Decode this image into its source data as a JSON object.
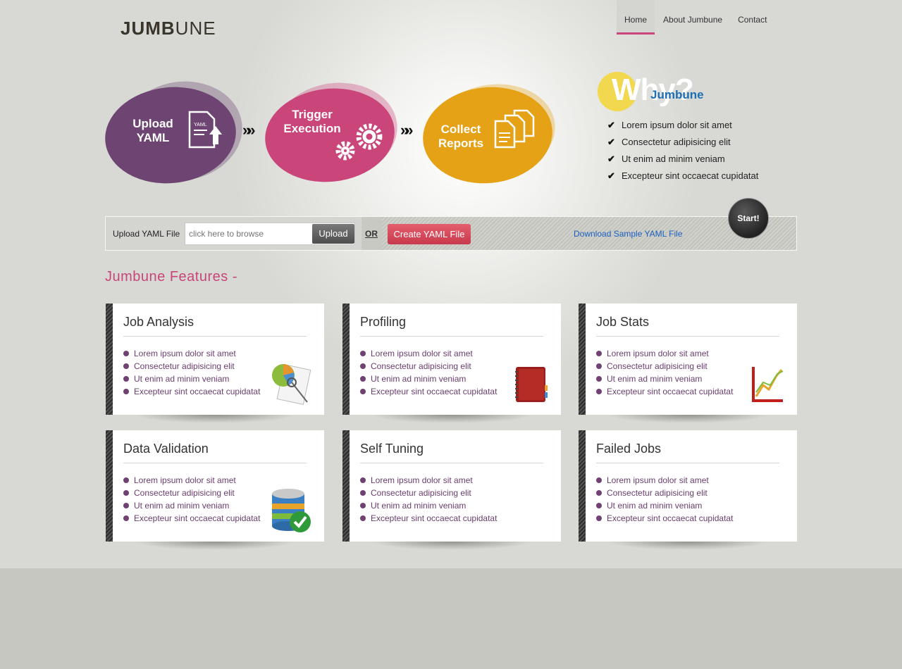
{
  "logo": {
    "bold": "JUMB",
    "rest": "UNE"
  },
  "nav": [
    {
      "label": "Home",
      "active": true
    },
    {
      "label": "About Jumbune",
      "active": false
    },
    {
      "label": "Contact",
      "active": false
    }
  ],
  "process": [
    {
      "label_line1": "Upload",
      "label_line2": "YAML",
      "color": "#6e4473",
      "icon": "yaml-upload-icon",
      "icon_text": "YAML"
    },
    {
      "label_line1": "Trigger",
      "label_line2": "Execution",
      "color": "#c9457a",
      "icon": "gears-icon"
    },
    {
      "label_line1": "Collect",
      "label_line2": "Reports",
      "color": "#e5a217",
      "icon": "documents-icon"
    }
  ],
  "why": {
    "title": "Why?",
    "subtitle": "Jumbune",
    "items": [
      "Lorem ipsum dolor sit amet",
      "Consectetur adipisicing elit",
      "Ut enim ad minim veniam",
      "Excepteur sint occaecat cupidatat"
    ]
  },
  "upload_bar": {
    "label": "Upload YAML File",
    "placeholder": "click here to browse",
    "upload_button": "Upload",
    "or_text": "OR",
    "create_button": "Create YAML File",
    "download_link": "Download Sample YAML File",
    "start_button": "Start!"
  },
  "features_title": "Jumbune Features -",
  "features": [
    {
      "title": "Job Analysis",
      "icon": "pie-chart-report-icon",
      "items": [
        "Lorem ipsum dolor sit amet",
        "Consectetur adipisicing elit",
        "Ut enim ad minim veniam",
        "Excepteur sint occaecat cupidatat"
      ]
    },
    {
      "title": "Profiling",
      "icon": "notebook-icon",
      "items": [
        "Lorem ipsum dolor sit amet",
        "Consectetur adipisicing elit",
        "Ut enim ad minim veniam",
        "Excepteur sint occaecat cupidatat"
      ]
    },
    {
      "title": "Job Stats",
      "icon": "line-graph-icon",
      "items": [
        "Lorem ipsum dolor sit amet",
        "Consectetur adipisicing elit",
        "Ut enim ad minim veniam",
        "Excepteur sint occaecat cupidatat"
      ]
    },
    {
      "title": "Data Validation",
      "icon": "database-check-icon",
      "items": [
        "Lorem ipsum dolor sit amet",
        "Consectetur adipisicing elit",
        "Ut enim ad minim veniam",
        "Excepteur sint occaecat cupidatat"
      ]
    },
    {
      "title": "Self Tuning",
      "icon": "",
      "items": [
        "Lorem ipsum dolor sit amet",
        "Consectetur adipisicing elit",
        "Ut enim ad minim veniam",
        "Excepteur sint occaecat cupidatat"
      ]
    },
    {
      "title": "Failed Jobs",
      "icon": "",
      "items": [
        "Lorem ipsum dolor sit amet",
        "Consectetur adipisicing elit",
        "Ut enim ad minim veniam",
        "Excepteur sint occaecat cupidatat"
      ]
    }
  ],
  "colors": {
    "accent_pink": "#c9457a",
    "purple": "#6e4473",
    "orange": "#e5a217",
    "link_blue": "#1b5fbf",
    "why_blue": "#1d6fb5",
    "why_yellow": "#f2d84e"
  }
}
